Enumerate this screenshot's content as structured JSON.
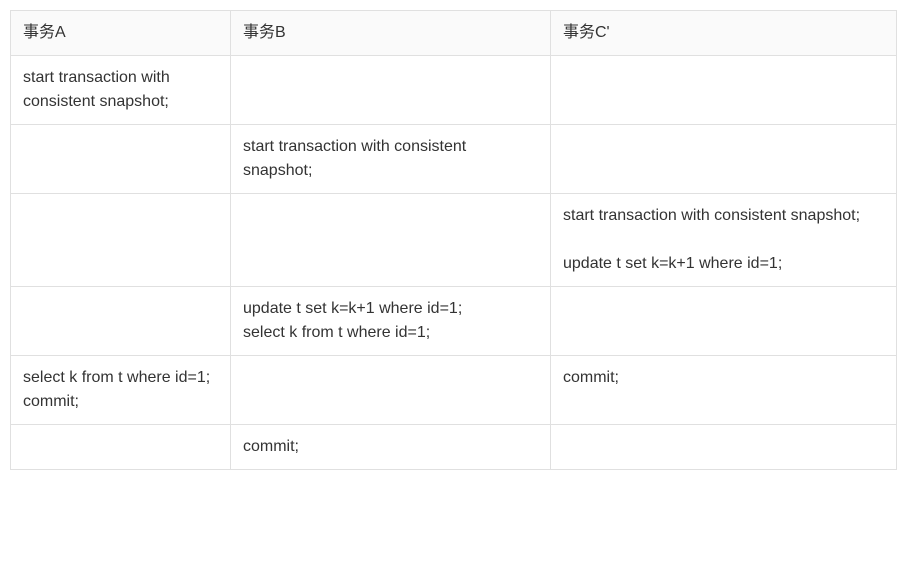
{
  "table": {
    "headers": [
      "事务A",
      "事务B",
      "事务C'"
    ],
    "rows": [
      [
        "start transaction with consistent snapshot;",
        "",
        ""
      ],
      [
        "",
        "start transaction with consistent snapshot;",
        ""
      ],
      [
        "",
        "",
        "start transaction with consistent snapshot;\n\nupdate t set k=k+1 where id=1;"
      ],
      [
        "",
        "update t set k=k+1 where id=1;\nselect k from t where id=1;",
        ""
      ],
      [
        "select k from t where id=1;\ncommit;",
        "",
        "commit;"
      ],
      [
        "",
        "commit;",
        ""
      ]
    ]
  }
}
